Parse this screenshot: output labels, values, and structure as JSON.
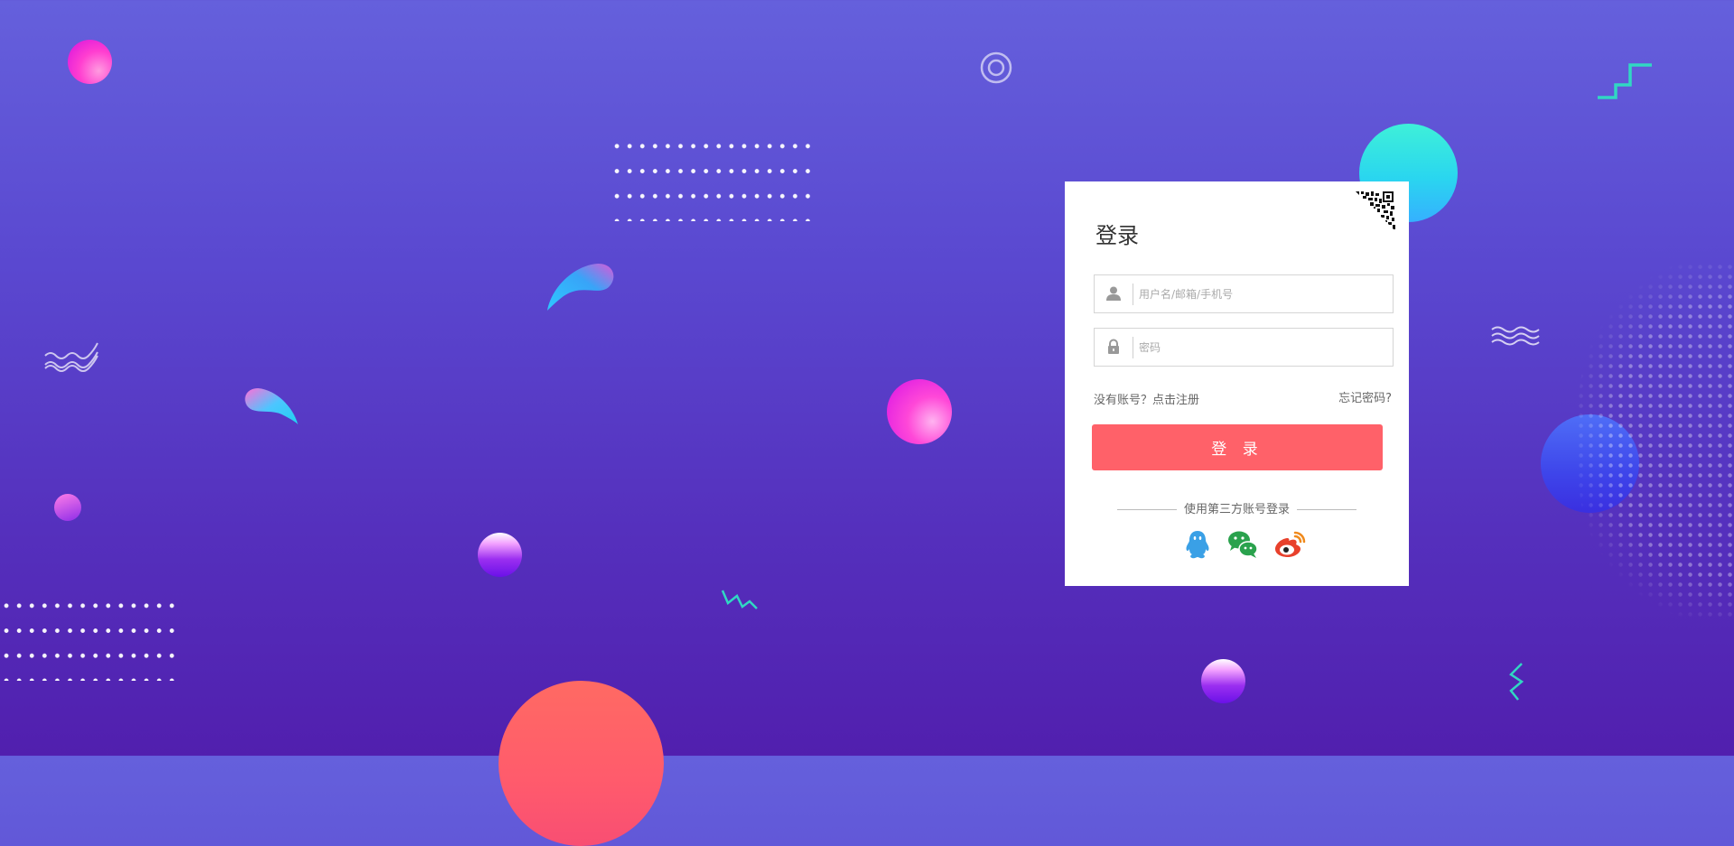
{
  "login": {
    "title": "登录",
    "username_placeholder": "用户名/邮箱/手机号",
    "password_placeholder": "密码",
    "register_text": "没有账号？点击注册",
    "forgot_text": "忘记密码?",
    "login_button": "登 录",
    "third_party_text": "使用第三方账号登录",
    "social": [
      {
        "name": "qq-icon",
        "color": "#3aa0e6"
      },
      {
        "name": "wechat-icon",
        "color": "#2aa24d"
      },
      {
        "name": "weibo-icon",
        "color": "#e8412c"
      }
    ]
  },
  "colors": {
    "accent": "#ff6169",
    "background_top": "#6560dc",
    "background_bottom": "#511fae"
  }
}
